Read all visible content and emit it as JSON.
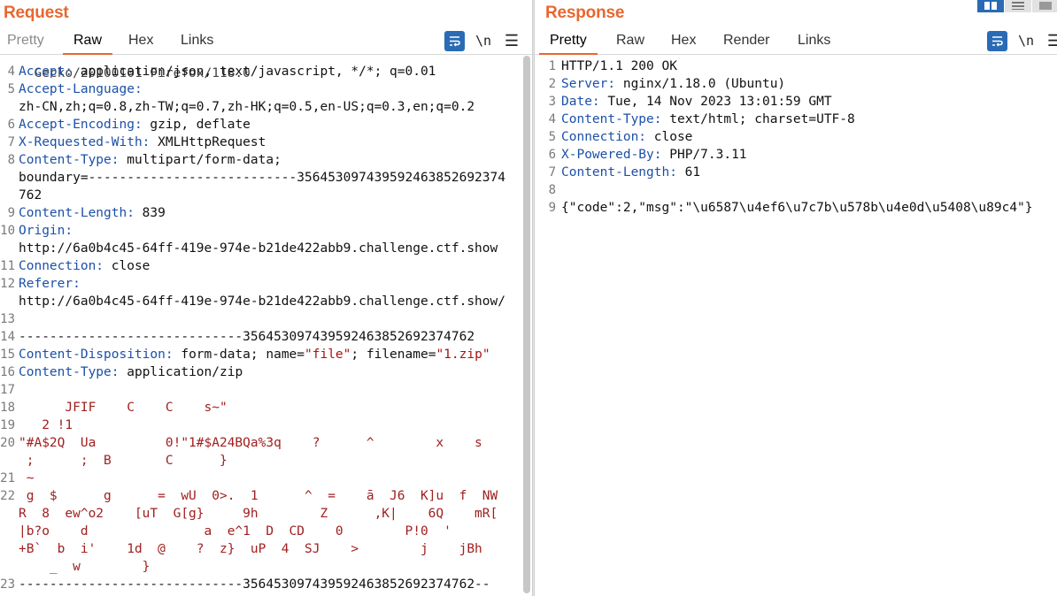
{
  "request": {
    "title": "Request",
    "tabs": [
      "Pretty",
      "Raw",
      "Hex",
      "Links"
    ],
    "active_tab": "Raw",
    "tools": {
      "wrap_icon": "wrap-lines-icon",
      "newline_label": "\\n",
      "menu_label": "☰"
    },
    "partial_line": "  Gecko/20100101 Firefox/118.0",
    "lines": [
      {
        "n": "4",
        "key": "Accept:",
        "value": " application/json, text/javascript, */*; q=0.01"
      },
      {
        "n": "5",
        "key": "Accept-Language:",
        "value": ""
      },
      {
        "n": "",
        "key": "",
        "value": "zh-CN,zh;q=0.8,zh-TW;q=0.7,zh-HK;q=0.5,en-US;q=0.3,en;q=0.2"
      },
      {
        "n": "6",
        "key": "Accept-Encoding:",
        "value": " gzip, deflate"
      },
      {
        "n": "7",
        "key": "X-Requested-With:",
        "value": " XMLHttpRequest"
      },
      {
        "n": "8",
        "key": "Content-Type:",
        "value": " multipart/form-data;"
      },
      {
        "n": "",
        "key": "",
        "value": "boundary=---------------------------35645309743959246385269237​4"
      },
      {
        "n": "",
        "key": "",
        "value": "762"
      },
      {
        "n": "9",
        "key": "Content-Length:",
        "value": " 839"
      },
      {
        "n": "10",
        "key": "Origin:",
        "value": ""
      },
      {
        "n": "",
        "key": "",
        "value": "http://6a0b4c45-64ff-419e-974e-b21de422abb9.challenge.ctf.show"
      },
      {
        "n": "11",
        "key": "Connection:",
        "value": " close"
      },
      {
        "n": "12",
        "key": "Referer:",
        "value": ""
      },
      {
        "n": "",
        "key": "",
        "value": "http://6a0b4c45-64ff-419e-974e-b21de422abb9.challenge.ctf.show/"
      },
      {
        "n": "13",
        "key": "",
        "value": ""
      },
      {
        "n": "14",
        "key": "",
        "value": "-----------------------------356453097439592463852692374762"
      },
      {
        "n": "15",
        "key": "Content-Disposition:",
        "value": " form-data; name=",
        "s1": "\"file\"",
        "mid": "; filename=",
        "s2": "\"1.zip\""
      },
      {
        "n": "16",
        "key": "Content-Type:",
        "value": " application/zip"
      },
      {
        "n": "17",
        "key": "",
        "value": ""
      },
      {
        "n": "18",
        "bin": "      JFIF    C    C    s~\""
      },
      {
        "n": "19",
        "bin": "   2 !1"
      },
      {
        "n": "20",
        "bin": "\"#A$2Q  Ua         0!\"1#$A24BQa%3q    ?      ^        x    s"
      },
      {
        "n": "",
        "bin": " ;      ;  B       C      }"
      },
      {
        "n": "21",
        "bin": " ~"
      },
      {
        "n": "22",
        "bin": " g  $      g      =  wU  0>.  1      ^  =    ā  J6  K]u  f  NW"
      },
      {
        "n": "",
        "bin": "R  8  ew^o2    [uT  G[g}     9h        Z      ,K|    6Q    mR["
      },
      {
        "n": "",
        "bin": "|b?o    d               a  e^1  D  CD    0        P!0  '"
      },
      {
        "n": "",
        "bin": "+B`  b  i'    1d  @    ?  z}  uP  4  SJ    >        j    jBh"
      },
      {
        "n": "",
        "bin": "    _  w        }"
      },
      {
        "n": "23",
        "key": "",
        "value": "-----------------------------356453097439592463852692374762--"
      }
    ]
  },
  "response": {
    "title": "Response",
    "tabs": [
      "Pretty",
      "Raw",
      "Hex",
      "Render",
      "Links"
    ],
    "active_tab": "Pretty",
    "tools": {
      "wrap_icon": "wrap-lines-icon",
      "newline_label": "\\n",
      "menu_label": "☰"
    },
    "lines": [
      {
        "n": "1",
        "key": "",
        "value": "HTTP/1.1 200 OK"
      },
      {
        "n": "2",
        "key": "Server:",
        "value": " nginx/1.18.0 (Ubuntu)"
      },
      {
        "n": "3",
        "key": "Date:",
        "value": " Tue, 14 Nov 2023 13:01:59 GMT"
      },
      {
        "n": "4",
        "key": "Content-Type:",
        "value": " text/html; charset=UTF-8"
      },
      {
        "n": "5",
        "key": "Connection:",
        "value": " close"
      },
      {
        "n": "6",
        "key": "X-Powered-By:",
        "value": " PHP/7.3.11"
      },
      {
        "n": "7",
        "key": "Content-Length:",
        "value": " 61"
      },
      {
        "n": "8",
        "key": "",
        "value": ""
      },
      {
        "n": "9",
        "key": "",
        "value": "{\"code\":2,\"msg\":\"\\u6587\\u4ef6\\u7c7b\\u578b\\u4e0d\\u5408\\u89c4\"}"
      }
    ]
  },
  "colors": {
    "accent": "#e8672f",
    "key": "#1c50a8",
    "binary": "#a02020",
    "button": "#2a6bb5"
  }
}
